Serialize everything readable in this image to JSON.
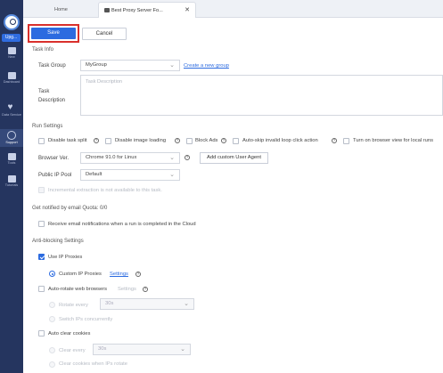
{
  "sidebar": {
    "upgrade_label": "Upg...",
    "items": [
      {
        "label": "New",
        "icon": "plus-box-icon"
      },
      {
        "label": "Dashboard",
        "icon": "dashboard-icon"
      },
      {
        "label": "Data Service",
        "icon": "heart-icon"
      },
      {
        "label": "Support",
        "icon": "headset-icon"
      },
      {
        "label": "Tools",
        "icon": "toolbox-icon"
      },
      {
        "label": "Tutorials",
        "icon": "graduation-cap-icon"
      }
    ]
  },
  "tabs": [
    {
      "label": "Home"
    },
    {
      "label": "Best Proxy Server Fo..."
    }
  ],
  "toolbar": {
    "save_label": "Save",
    "cancel_label": "Cancel"
  },
  "task_info": {
    "section_title": "Task Info",
    "group_label": "Task Group",
    "group_value": "MyGroup",
    "create_group_link": "Create a new group",
    "description_label": "Task Description",
    "description_placeholder": "Task Description"
  },
  "run_settings": {
    "section_title": "Run Settings",
    "options": [
      "Disable task split",
      "Disable image loading",
      "Block Ads",
      "Auto-skip invalid loop click action",
      "Turn on browser view for local runs"
    ],
    "browser_label": "Browser Ver.",
    "browser_value": "Chrome 91.0 for Linux",
    "add_agent_label": "Add custom User Agent",
    "ip_pool_label": "Public IP Pool",
    "ip_pool_value": "Default",
    "incremental_label": "Incremental extraction is not available to this task."
  },
  "notify": {
    "section_title": "Get notified by email Quota: 0/0",
    "email_label": "Receive email notifications when a run is completed in the Cloud"
  },
  "anti_blocking": {
    "section_title": "Anti-blocking Settings",
    "use_ip_label": "Use IP Proxies",
    "custom_ip_label": "Custom IP Proxies",
    "settings_link": "Settings",
    "auto_rotate_label": "Auto-rotate web browsers",
    "auto_rotate_settings": "Settings",
    "rotate_every_label": "Rotate every",
    "rotate_every_value": "30s",
    "switch_ips_label": "Switch IPs concurrently",
    "auto_clear_label": "Auto clear cookies",
    "clear_every_label": "Clear every",
    "clear_every_value": "30s",
    "clear_when_label": "Clear cookies when IPs rotate"
  },
  "colors": {
    "accent": "#2c6be0",
    "sidebar": "#25355f",
    "highlight": "#d9302c"
  }
}
